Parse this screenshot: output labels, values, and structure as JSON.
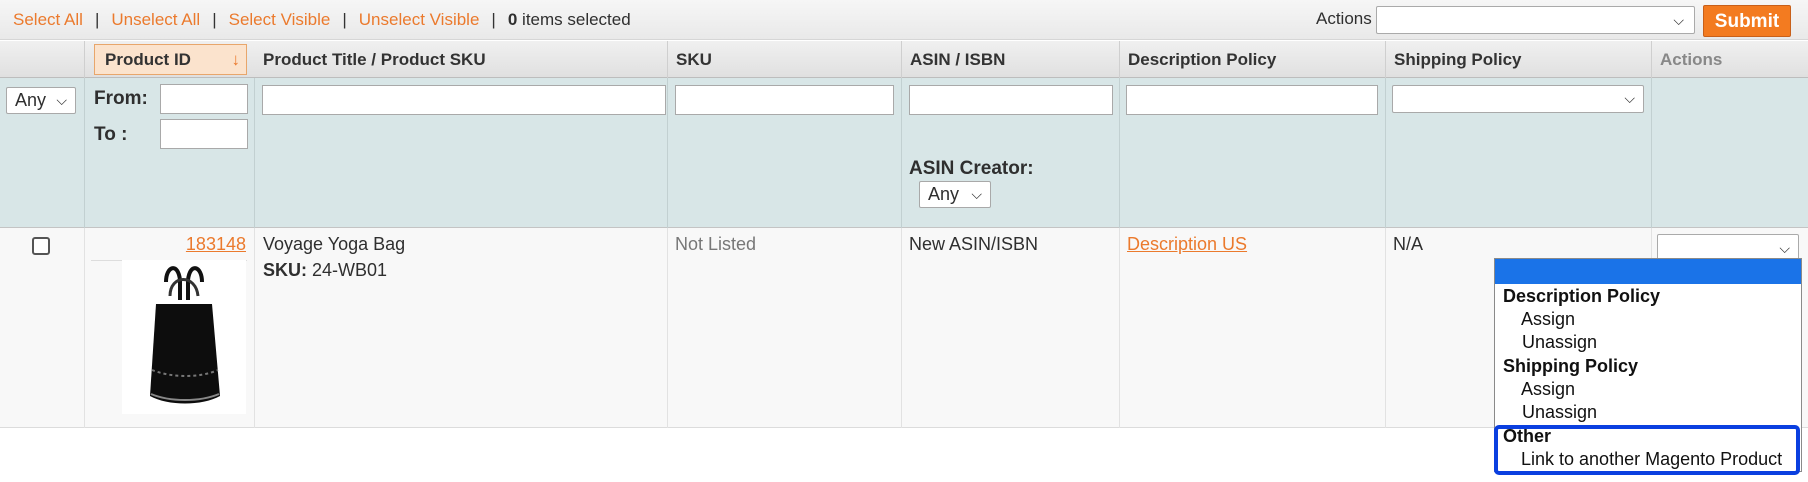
{
  "massaction": {
    "select_all": "Select All",
    "unselect_all": "Unselect All",
    "select_visible": "Select Visible",
    "unselect_visible": "Unselect Visible",
    "separator": "|",
    "selected_count": "0",
    "selected_suffix": " items selected",
    "actions_label": "Actions",
    "actions_value": "",
    "submit_label": "Submit"
  },
  "columns": {
    "product_id": "Product ID",
    "title_sku": "Product Title / Product SKU",
    "sku": "SKU",
    "asin": "ASIN / ISBN",
    "description_policy": "Description Policy",
    "shipping_policy": "Shipping Policy",
    "actions": "Actions"
  },
  "filters": {
    "massaction_any": "Any",
    "from_label": "From:",
    "to_label": "To :",
    "asin_creator_label": "ASIN Creator:",
    "asin_creator_value": "Any",
    "shipping_value": ""
  },
  "row": {
    "product_id": "183148",
    "title": "Voyage Yoga Bag",
    "sku_label": "SKU:",
    "sku_value": "24-WB01",
    "sku_status": "Not Listed",
    "asin": "New ASIN/ISBN",
    "description_policy": "Description US",
    "shipping_policy": "N/A"
  },
  "action_dropdown": {
    "groups": [
      {
        "label": "Description Policy",
        "options": [
          "Assign",
          "Unassign"
        ]
      },
      {
        "label": "Shipping Policy",
        "options": [
          "Assign",
          "Unassign"
        ]
      },
      {
        "label": "Other",
        "options": [
          "Link to another Magento Product"
        ]
      }
    ]
  },
  "colors": {
    "accent": "#eb7a2d",
    "submit": "#f37b20",
    "filter_bg": "#d8e6e7",
    "highlight_box": "#0a3fe0",
    "selected_option": "#1a73e8"
  }
}
